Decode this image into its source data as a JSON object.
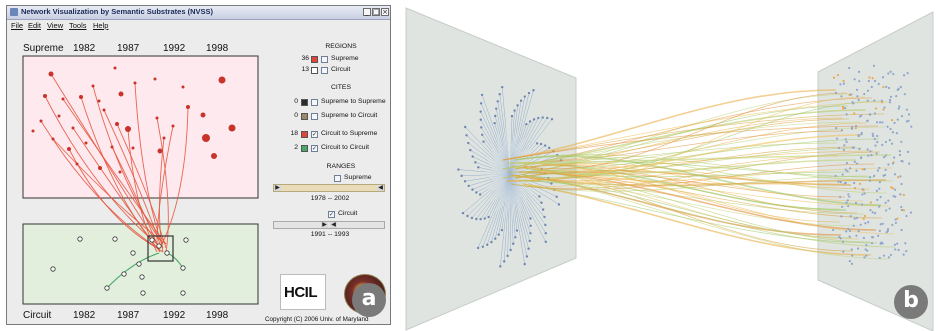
{
  "window": {
    "title": "Network Visualization by Semantic Substrates (NVSS)",
    "controls": [
      "_",
      "□",
      "×"
    ]
  },
  "menu": [
    "File",
    "Edit",
    "View",
    "Tools",
    "Help"
  ],
  "top_region": {
    "name": "Supreme",
    "years": [
      "1982",
      "1987",
      "1992",
      "1998"
    ]
  },
  "bottom_region": {
    "name": "Circuit",
    "years": [
      "1982",
      "1987",
      "1992",
      "1998"
    ]
  },
  "regions": {
    "header": "REGIONS",
    "items": [
      {
        "count": "36",
        "color": "#e0443a",
        "checked": false,
        "label": "Supreme"
      },
      {
        "count": "13",
        "color": "#ffffff",
        "checked": false,
        "label": "Circuit"
      }
    ]
  },
  "cites": {
    "header": "CITES",
    "items": [
      {
        "count": "0",
        "color": "#2b2b2b",
        "checked": false,
        "label": "Supreme to Supreme"
      },
      {
        "count": "0",
        "color": "#9a8a6a",
        "checked": false,
        "label": "Supreme to Circuit"
      },
      {
        "count": "18",
        "color": "#e0443a",
        "checked": true,
        "label": "Circuit to Supreme"
      },
      {
        "count": "2",
        "color": "#4aa86a",
        "checked": true,
        "label": "Circuit to Circuit"
      }
    ]
  },
  "ranges": {
    "header": "RANGES",
    "items": [
      {
        "label": "Supreme",
        "checked": false,
        "range": "1978 -- 2002"
      },
      {
        "label": "Circuit",
        "checked": true,
        "range": "1991 -- 1993"
      }
    ]
  },
  "copyright": "Copyright (C) 2006 Univ. of Maryland",
  "logo_text": "HCIL",
  "panel_labels": {
    "a": "a",
    "b": "b"
  },
  "colors": {
    "supreme_fill": "#fde9ee",
    "circuit_fill": "#e2efdc",
    "edge_red": "#e8553f",
    "edge_green": "#4aa86a",
    "node_red": "#c9342a"
  }
}
